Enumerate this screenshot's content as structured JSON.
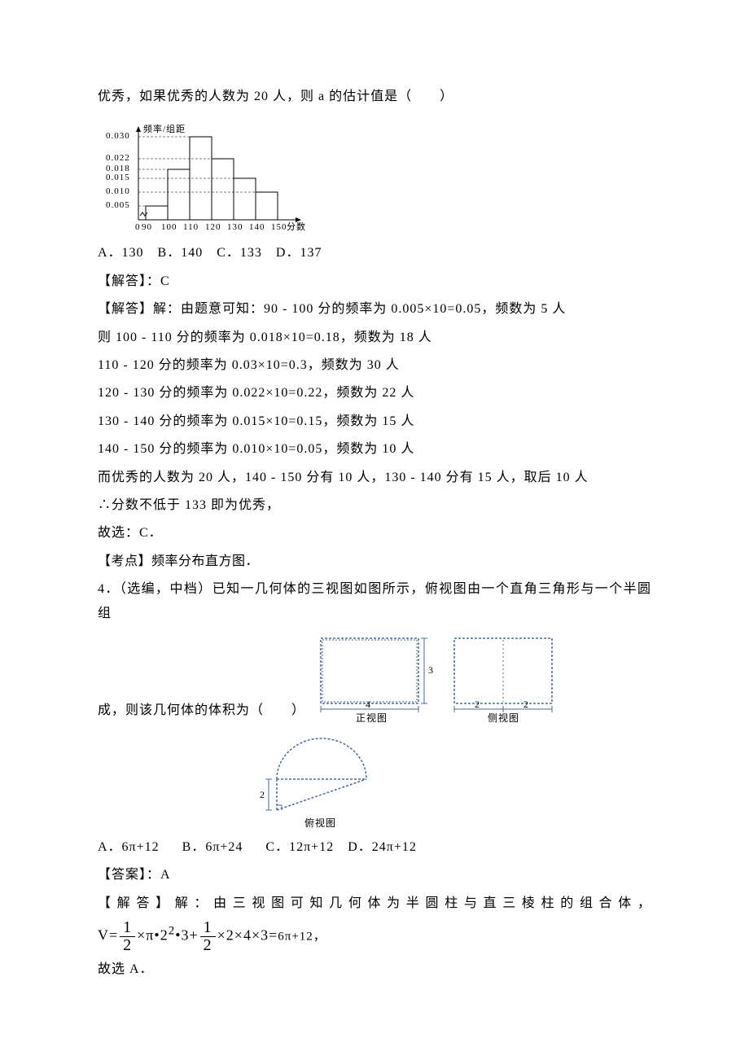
{
  "chart_data": {
    "type": "bar",
    "categories": [
      90,
      100,
      110,
      120,
      130,
      140,
      150
    ],
    "values": [
      0.005,
      0.018,
      0.03,
      0.022,
      0.015,
      0.01
    ],
    "ylabel": "频率/组距",
    "xlabel": "分数",
    "y_ticks": [
      0.005,
      0.01,
      0.015,
      0.018,
      0.022,
      0.03
    ]
  },
  "q3": {
    "stem": "优秀，如果优秀的人数为 20 人，则 a 的估计值是（　　）",
    "choices": "A．130　B．140　C．133　D．137",
    "ans_label": "【解答】：C",
    "sol_intro": "【解答】解：由题意可知：90 - 100 分的频率为 0.005×10=0.05，频数为 5 人",
    "sol_l2": "则 100 - 110 分的频率为 0.018×10=0.18，频数为 18 人",
    "sol_l3": "110 - 120 分的频率为 0.03×10=0.3，频数为 30 人",
    "sol_l4": "120 - 130 分的频率为 0.022×10=0.22，频数为 22 人",
    "sol_l5": "130 - 140 分的频率为 0.015×10=0.15，频数为 15 人",
    "sol_l6": "140 - 150 分的频率为 0.010×10=0.05，频数为 10 人",
    "sol_l7": "而优秀的人数为 20 人，140 - 150 分有 10 人，130 - 140 分有 15 人，取后 10 人",
    "sol_l8": "∴分数不低于 133 即为优秀，",
    "sol_l9": "故选：C．",
    "kaopoint": "【考点】频率分布直方图．"
  },
  "q4": {
    "stem_a": "4．（选编，中档）已知一几何体的三视图如图所示，俯视图由一个直角三角形与一个半圆组",
    "stem_b": "成，则该几何体的体积为（　　）",
    "views": {
      "front": "正视图",
      "side": "侧视图",
      "top": "俯视图"
    },
    "dims": {
      "w": "4",
      "h": "3",
      "s": "2",
      "r": "2"
    },
    "choices": "A．6π+12　 B．6π+24　 C．12π+12　D．24π+12",
    "ans_label": "【答案】：A",
    "sol_intro": "【解答】解：由三视图可知几何体为半圆柱与直三棱柱的组合体，",
    "formula_prefix": "V=",
    "formula_mid1": "×π•2",
    "formula_sup1": "2",
    "formula_mid2": "•3+",
    "formula_mid3": "×2×4×3=",
    "formula_tail": "6π+12，",
    "frac_num": "1",
    "frac_den": "2",
    "sol_end": "故选 A．"
  }
}
